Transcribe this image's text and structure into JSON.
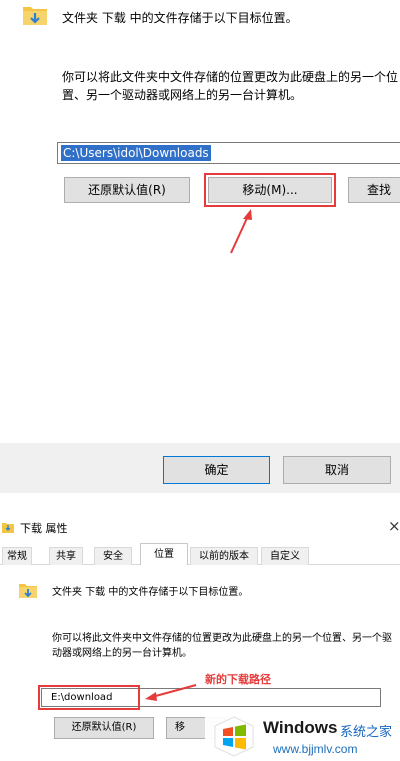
{
  "top_panel": {
    "description": "文件夹 下载 中的文件存储于以下目标位置。",
    "paragraph": "你可以将此文件夹中文件存储的位置更改为此硬盘上的另一个位置、另一个驱动器或网络上的另一台计算机。",
    "path_value": "C:\\Users\\idol\\Downloads",
    "restore_label": "还原默认值(R)",
    "move_label": "移动(M)...",
    "find_label": "查找",
    "ok_label": "确定",
    "cancel_label": "取消"
  },
  "bottom_window": {
    "title": "下载 属性",
    "close_glyph": "×",
    "tabs": [
      {
        "label": "常规"
      },
      {
        "label": "共享"
      },
      {
        "label": "安全"
      },
      {
        "label": "位置"
      },
      {
        "label": "以前的版本"
      },
      {
        "label": "自定义"
      }
    ],
    "active_tab": "位置",
    "description": "文件夹 下载 中的文件存储于以下目标位置。",
    "paragraph": "你可以将此文件夹中文件存储的位置更改为此硬盘上的另一个位置、另一个驱动器或网络上的另一台计算机。",
    "path_value": "E:\\download",
    "annotation": "新的下载路径",
    "restore_label": "还原默认值(R)",
    "move_label": "移"
  },
  "watermark": {
    "name": "Windows",
    "sub": "系统之家",
    "url": "www.bjjmlv.com"
  },
  "colors": {
    "highlight_red": "#e53b3b",
    "selection_blue": "#3070c8",
    "folder_yellow": "#f4c542",
    "arrow_blue": "#2d7fd3"
  },
  "icons": {
    "folder": "folder-download-icon",
    "close": "close-icon",
    "annotation_arrow": "red-arrow",
    "logo": "windows-logo-icon"
  }
}
